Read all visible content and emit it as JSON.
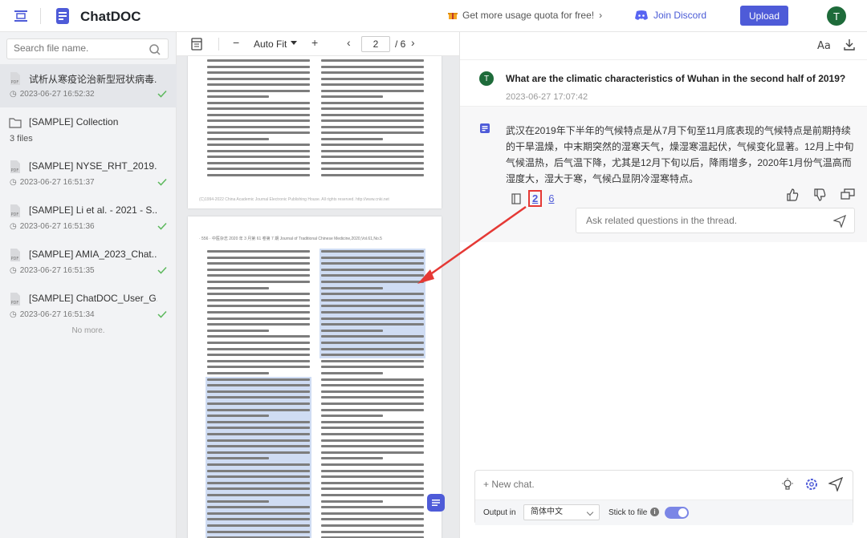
{
  "header": {
    "app_title": "ChatDOC",
    "promo_text": "Get more usage quota for free!",
    "discord_text": "Join Discord",
    "upload_label": "Upload",
    "avatar_initial": "T"
  },
  "sidebar": {
    "search_placeholder": "Search file name.",
    "files": [
      {
        "name": "试析从寒疫论治新型冠状病毒...",
        "time": "2023-06-27 16:52:32",
        "active": true
      },
      {
        "name": "[SAMPLE] Collection",
        "time": "3 files",
        "folder": true
      },
      {
        "name": "[SAMPLE] NYSE_RHT_2019...",
        "time": "2023-06-27 16:51:37"
      },
      {
        "name": "[SAMPLE] Li et al. - 2021 - S...",
        "time": "2023-06-27 16:51:36"
      },
      {
        "name": "[SAMPLE] AMIA_2023_Chat...",
        "time": "2023-06-27 16:51:35"
      },
      {
        "name": "[SAMPLE] ChatDOC_User_G...",
        "time": "2023-06-27 16:51:34"
      }
    ],
    "no_more": "No more."
  },
  "pdf_toolbar": {
    "minus": "−",
    "zoom": "Auto Fit",
    "plus": "+",
    "prev": "‹",
    "current_page": "2",
    "total_pages": "/ 6",
    "next": "›"
  },
  "pdf": {
    "page1_footer": "(C)1994-2022 China Academic Journal Electronic Publishing House. All rights reserved.    http://www.cnki.net",
    "page2_header": "· 556 ·        中医杂志 2020 年 3 月第 61 卷第 7 期 Journal of Traditional Chinese Medicine,2020,Vol.61,No.5"
  },
  "chat": {
    "question": "What are the climatic characteristics of Wuhan in the second half of 2019?",
    "question_time": "2023-06-27 17:07:42",
    "answer": "武汉在2019年下半年的气候特点是从7月下旬至11月底表现的气候特点是前期持续的干旱温燥，中末期突然的湿寒天气，燥湿寒温起伏，气候变化显著。12月上中旬气候温热，后气温下降，尤其是12月下旬以后，降雨增多，2020年1月份气温高而湿度大，湿大于寒，气候凸显阴冷湿寒特点。",
    "refs": [
      "2",
      "6"
    ],
    "thread_placeholder": "Ask related questions in the thread.",
    "new_chat_placeholder": "+ New chat.",
    "output_label": "Output in",
    "output_value": "简体中文",
    "stick_label": "Stick to file",
    "info_glyph": "i"
  },
  "colors": {
    "accent": "#4e5bd8",
    "avatar": "#1e6b3a",
    "highlight": "#cfdcf3",
    "annotation_red": "#e53935"
  }
}
